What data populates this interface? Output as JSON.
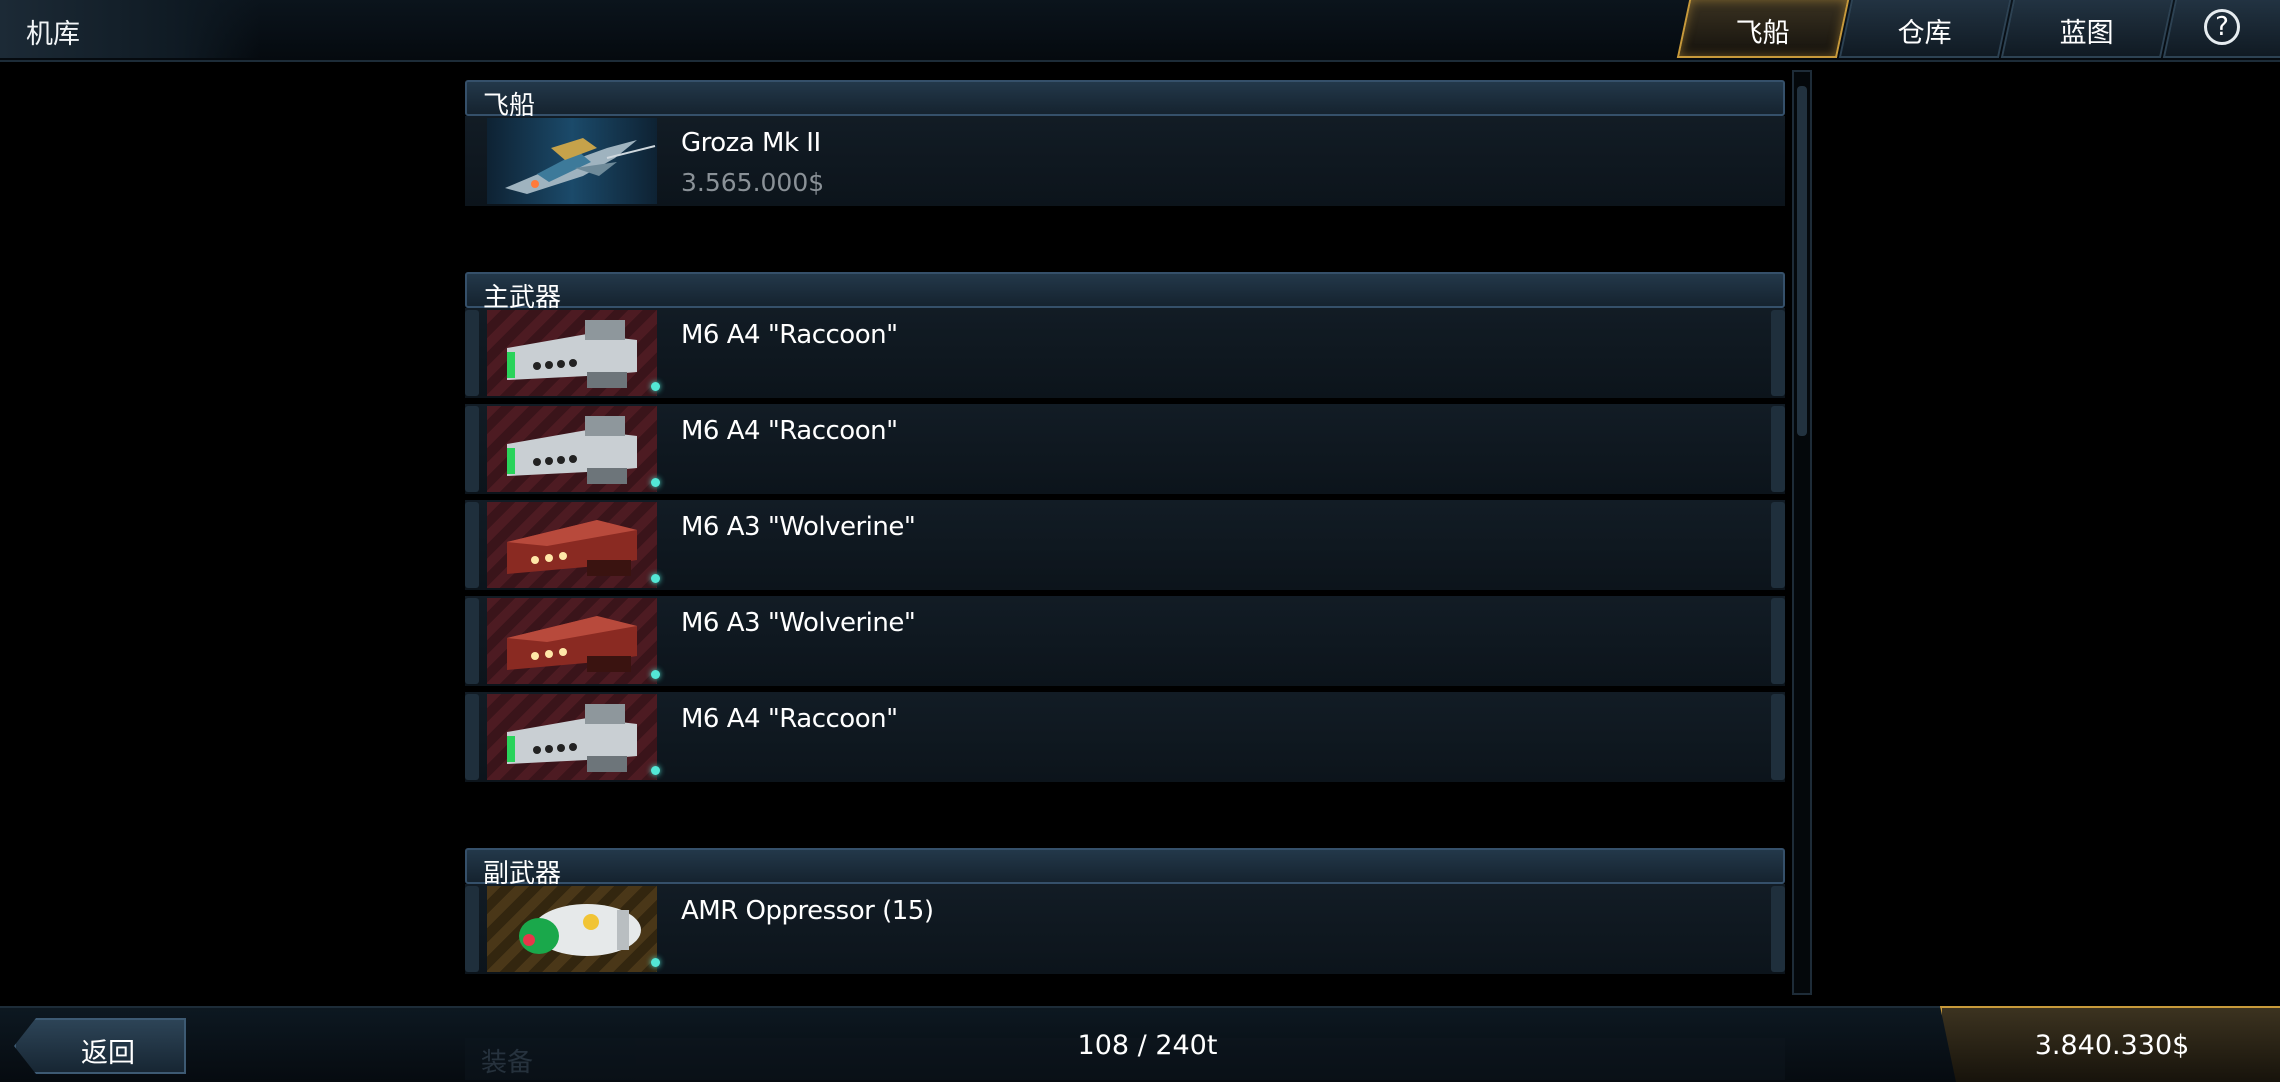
{
  "header": {
    "title": "机库",
    "tabs": [
      {
        "label": "飞船",
        "active": true
      },
      {
        "label": "仓库",
        "active": false
      },
      {
        "label": "蓝图",
        "active": false
      }
    ],
    "help_icon": "?"
  },
  "sections": [
    {
      "title": "飞船",
      "items": [
        {
          "name": "Groza Mk II",
          "price": "3.565.000$",
          "icon": "ship-icon"
        }
      ]
    },
    {
      "title": "主武器",
      "items": [
        {
          "name": "M6 A4 \"Raccoon\"",
          "icon": "raccoon-cannon-icon"
        },
        {
          "name": "M6 A4 \"Raccoon\"",
          "icon": "raccoon-cannon-icon"
        },
        {
          "name": "M6 A3 \"Wolverine\"",
          "icon": "wolverine-cannon-icon"
        },
        {
          "name": "M6 A3 \"Wolverine\"",
          "icon": "wolverine-cannon-icon"
        },
        {
          "name": "M6 A4 \"Raccoon\"",
          "icon": "raccoon-cannon-icon"
        }
      ]
    },
    {
      "title": "副武器",
      "items": [
        {
          "name": "AMR Oppressor (15)",
          "icon": "missile-icon"
        }
      ]
    },
    {
      "title": "装备",
      "items": []
    }
  ],
  "footer": {
    "back_label": "返回",
    "cargo": "108 / 240t",
    "money": "3.840.330$"
  },
  "colors": {
    "accent_gold": "#c89a3b",
    "status_dot": "#53e7d6",
    "panel": "#121c25"
  }
}
